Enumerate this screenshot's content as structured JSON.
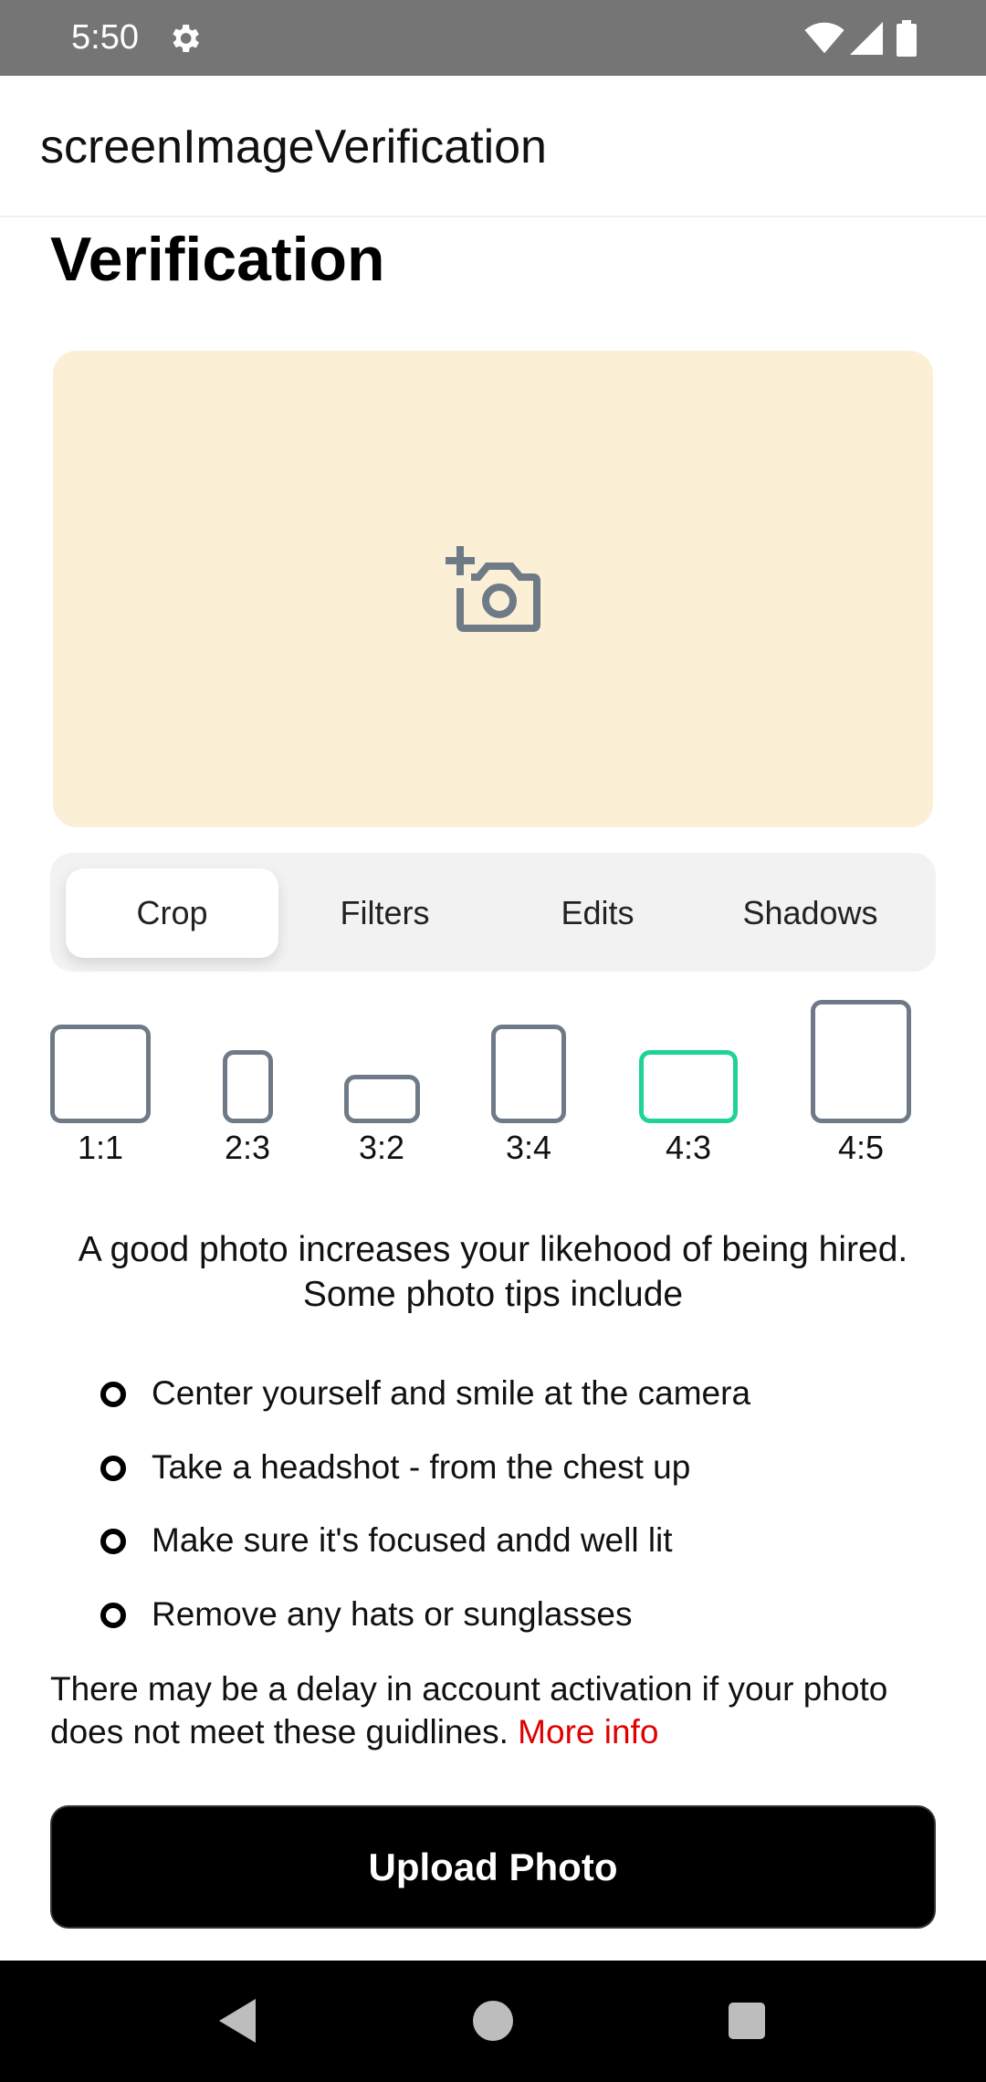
{
  "status_bar": {
    "time": "5:50"
  },
  "app_bar": {
    "title": "screenImageVerification"
  },
  "page": {
    "title": "Verification"
  },
  "tabs": [
    {
      "label": "Crop",
      "active": true
    },
    {
      "label": "Filters",
      "active": false
    },
    {
      "label": "Edits",
      "active": false
    },
    {
      "label": "Shadows",
      "active": false
    }
  ],
  "ratios": [
    {
      "label": "1:1",
      "selected": false
    },
    {
      "label": "2:3",
      "selected": false
    },
    {
      "label": "3:2",
      "selected": false
    },
    {
      "label": "3:4",
      "selected": false
    },
    {
      "label": "4:3",
      "selected": true
    },
    {
      "label": "4:5",
      "selected": false
    }
  ],
  "intro": "A good photo increases your likehood of being hired. Some photo tips include",
  "tips": [
    "Center yourself and smile at the camera",
    "Take a headshot - from the chest up",
    "Make sure it's focused andd well lit",
    "Remove any hats or sunglasses"
  ],
  "notice": {
    "text": "There may be a delay in account activation if your photo does not meet these guidlines.",
    "link": "More info"
  },
  "upload_button": "Upload Photo",
  "colors": {
    "status_bar": "#757575",
    "photo_area": "#fbf0d6",
    "selected_ratio": "#1fd492",
    "link": "#e00000",
    "button": "#000000"
  }
}
